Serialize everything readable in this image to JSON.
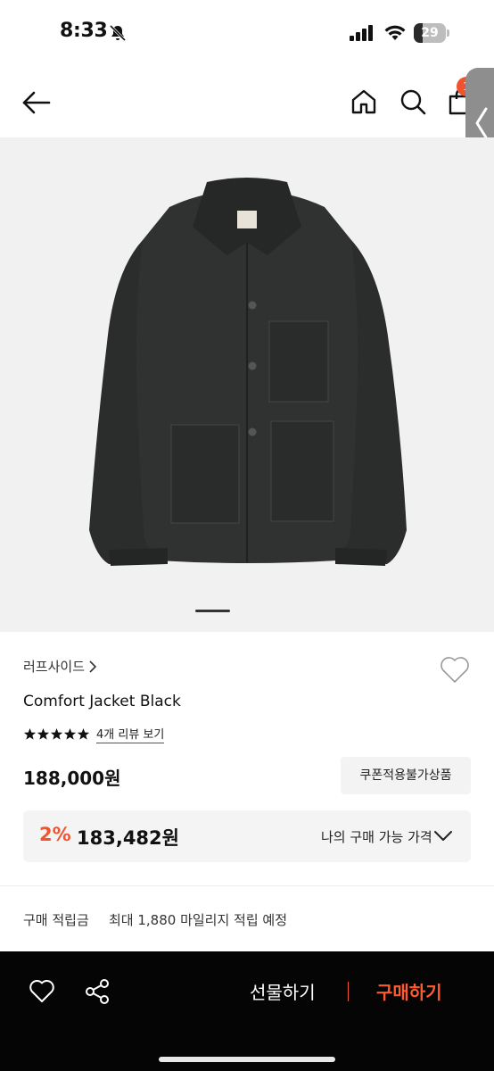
{
  "status_bar": {
    "time": "8:33",
    "battery": "29",
    "battery_level": 0.29
  },
  "nav": {
    "cart_count": "1"
  },
  "product": {
    "brand": "러프사이드",
    "name": "Comfort Jacket Black",
    "rating_stars": 5,
    "review_link": "4개 리뷰 보기",
    "price": "188,000원",
    "coupon_badge": "쿠폰적용불가상품",
    "image_page": 1
  },
  "my_price": {
    "discount": "2%",
    "price": "183,482원",
    "label": "나의 구매 가능 가격"
  },
  "points": {
    "label": "구매 적립금",
    "value": "최대 1,880 마일리지 적립 예정"
  },
  "bottom_bar": {
    "gift_label": "선물하기",
    "buy_label": "구매하기"
  },
  "colors": {
    "accent": "#f0532d",
    "bottom_bar": "#050505"
  },
  "icons": [
    "bell-slash-icon",
    "signal-icon",
    "wifi-icon",
    "back-arrow-icon",
    "home-icon",
    "search-icon",
    "shopping-bag-icon",
    "heart-outline-icon",
    "share-icon",
    "chevron-down-icon",
    "chevron-right-icon",
    "star-icon"
  ]
}
